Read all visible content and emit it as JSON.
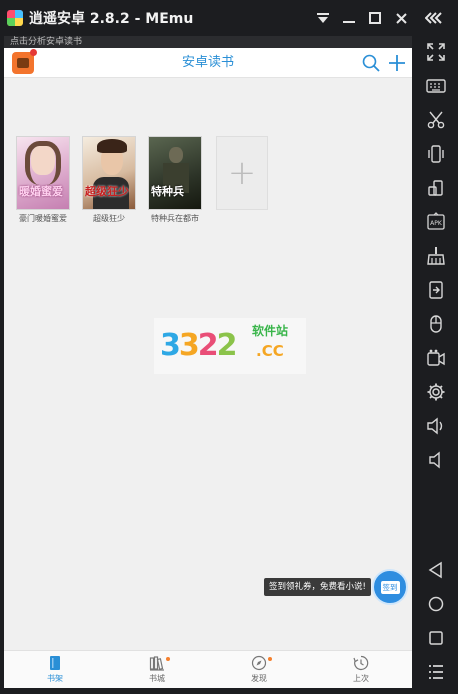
{
  "window": {
    "title": "逍遥安卓 2.8.2 - MEmu",
    "controls": {
      "menu_icon": "dropdown-icon",
      "minimize_icon": "minimize-icon",
      "maximize_icon": "maximize-icon",
      "close_icon": "close-icon",
      "collapse_icon": "collapse-icon"
    }
  },
  "notification": {
    "text": "点击分析安卓读书"
  },
  "app": {
    "title": "安卓读书",
    "accent": "#2a8fd6"
  },
  "books": [
    {
      "title": "豪门暖婚蜜爱",
      "cover_text": "暖婚蜜爱",
      "cover_color": "#e6b7d8"
    },
    {
      "title": "超级狂少",
      "cover_text": "超级狂少",
      "cover_color": "#d9c1a4"
    },
    {
      "title": "特种兵在都市",
      "cover_text": "特种兵",
      "cover_color": "#3d4a3a"
    }
  ],
  "add_tile": {
    "symbol": "+"
  },
  "watermark": {
    "number_parts": [
      "3",
      "3",
      "2",
      "2"
    ],
    "site": "软件站",
    "cc": ".CC"
  },
  "promo": {
    "tooltip": "签到领礼券，免费看小说!",
    "fab_label": "签到"
  },
  "bottom_nav": [
    {
      "label": "书架",
      "icon": "bookshelf-icon",
      "active": true
    },
    {
      "label": "书城",
      "icon": "bookstore-icon",
      "active": false
    },
    {
      "label": "发现",
      "icon": "compass-icon",
      "active": false
    },
    {
      "label": "上次",
      "icon": "history-icon",
      "active": false
    }
  ],
  "toolbar_icons": [
    "fullscreen-icon",
    "keyboard-icon",
    "scissors-icon",
    "shake-icon",
    "rotate-icon",
    "apk-icon",
    "clean-icon",
    "share-icon",
    "mouse-icon",
    "record-icon",
    "settings-icon",
    "volume-up-icon",
    "volume-down-icon",
    "back-icon",
    "home-icon",
    "recent-apps-icon",
    "menu-icon"
  ]
}
